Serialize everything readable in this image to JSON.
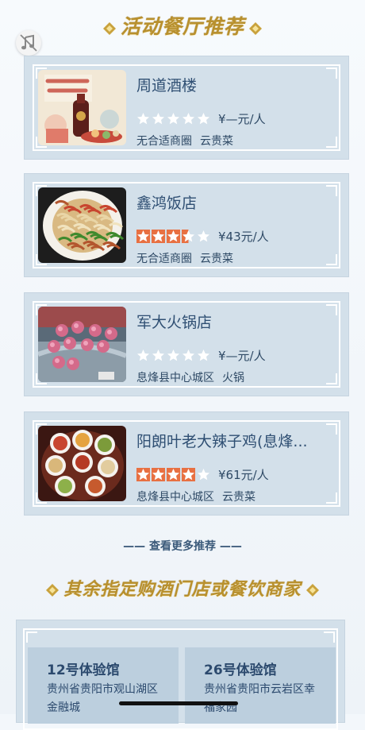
{
  "sections": {
    "recommend_title": "活动餐厅推荐",
    "stores_title": "其余指定购酒门店或餐饮商家"
  },
  "restaurants": [
    {
      "name": "周道酒楼",
      "rating": 0,
      "price": "¥—元/人",
      "district": "无合适商圈",
      "cuisine": "云贵菜",
      "thumb": "promo-poster"
    },
    {
      "name": "鑫鸿饭店",
      "rating": 3.5,
      "price": "¥43元/人",
      "district": "无合适商圈",
      "cuisine": "云贵菜",
      "thumb": "noodle-dish"
    },
    {
      "name": "军大火锅店",
      "rating": 0,
      "price": "¥—元/人",
      "district": "息烽县中心城区",
      "cuisine": "火锅",
      "thumb": "hotpot"
    },
    {
      "name": "阳朗叶老大辣子鸡(息烽...",
      "rating": 4,
      "price": "¥61元/人",
      "district": "息烽县中心城区",
      "cuisine": "云贵菜",
      "thumb": "table-spread"
    }
  ],
  "more_link": "—— 查看更多推荐 ——",
  "stores": [
    {
      "name": "12号体验馆",
      "address": "贵州省贵阳市观山湖区金融城"
    },
    {
      "name": "26号体验馆",
      "address": "贵州省贵阳市云岩区幸福家园"
    }
  ],
  "colors": {
    "star_filled": "#e87042",
    "star_empty": "#ffffff",
    "card_bg": "#d3e0ea",
    "title_gold": "#b8902e"
  },
  "icons": {
    "music": "music-note-icon",
    "ornament": "ornament-diamond-icon",
    "star": "star-icon"
  }
}
